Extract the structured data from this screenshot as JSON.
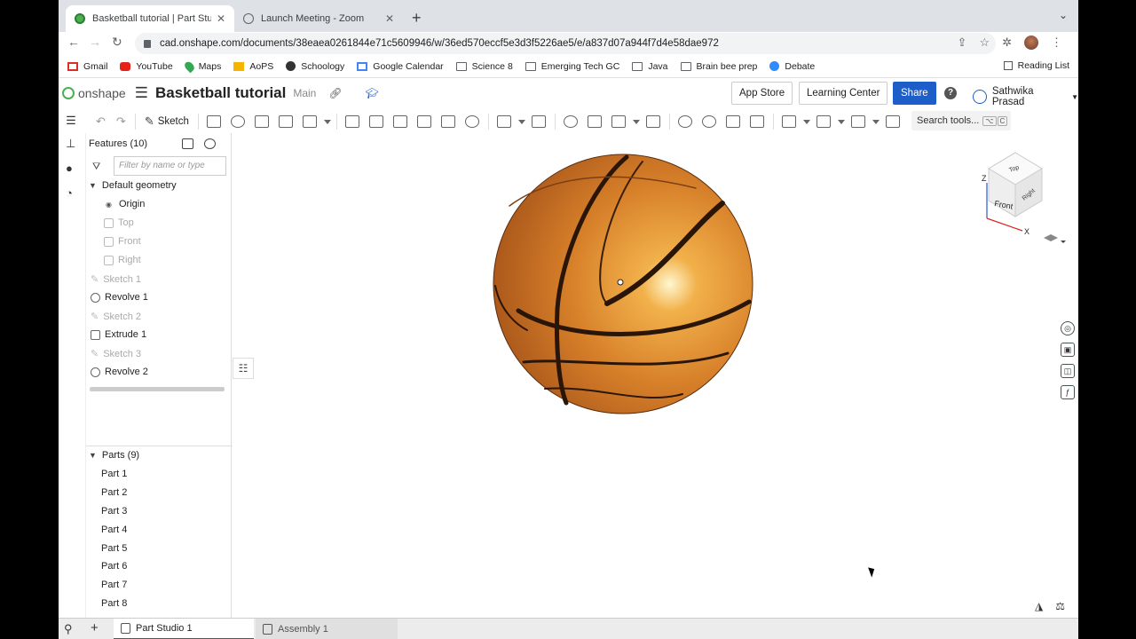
{
  "browser": {
    "tabs": [
      {
        "title": "Basketball tutorial | Part Studio 1",
        "favicon": "onshape-icon"
      },
      {
        "title": "Launch Meeting - Zoom",
        "favicon": "globe-icon"
      }
    ],
    "url": "cad.onshape.com/documents/38eaea0261844e71c5609946/w/36ed570eccf5e3d3f5226ae5/e/a837d07a944f7d4e58dae972",
    "bookmarks": [
      "Gmail",
      "YouTube",
      "Maps",
      "AoPS",
      "Schoology",
      "Google Calendar",
      "Science 8",
      "Emerging Tech GC",
      "Java",
      "Brain bee prep",
      "Debate"
    ],
    "reading_list": "Reading List"
  },
  "header": {
    "logo": "onshape",
    "doc_title": "Basketball tutorial",
    "branch": "Main",
    "app_store": "App Store",
    "learning_center": "Learning Center",
    "share": "Share",
    "user": "Sathwika Prasad",
    "accent": "#1e5ec8"
  },
  "toolbar": {
    "sketch": "Sketch",
    "search": "Search tools...",
    "shortcut1": "⌥",
    "shortcut2": "C"
  },
  "features": {
    "header": "Features (10)",
    "filter_placeholder": "Filter by name or type",
    "group": "Default geometry",
    "items": [
      {
        "label": "Origin"
      },
      {
        "label": "Top"
      },
      {
        "label": "Front"
      },
      {
        "label": "Right"
      },
      {
        "label": "Sketch 1"
      },
      {
        "label": "Revolve 1"
      },
      {
        "label": "Sketch 2"
      },
      {
        "label": "Extrude 1"
      },
      {
        "label": "Sketch 3"
      },
      {
        "label": "Revolve 2"
      }
    ]
  },
  "parts": {
    "header": "Parts (9)",
    "items": [
      "Part 1",
      "Part 2",
      "Part 3",
      "Part 4",
      "Part 5",
      "Part 6",
      "Part 7",
      "Part 8"
    ]
  },
  "viewcube": {
    "top": "Top",
    "front": "Front",
    "right": "Right",
    "axis_z": "Z",
    "axis_x": "X"
  },
  "bottom_tabs": [
    {
      "label": "Part Studio 1"
    },
    {
      "label": "Assembly 1"
    }
  ]
}
